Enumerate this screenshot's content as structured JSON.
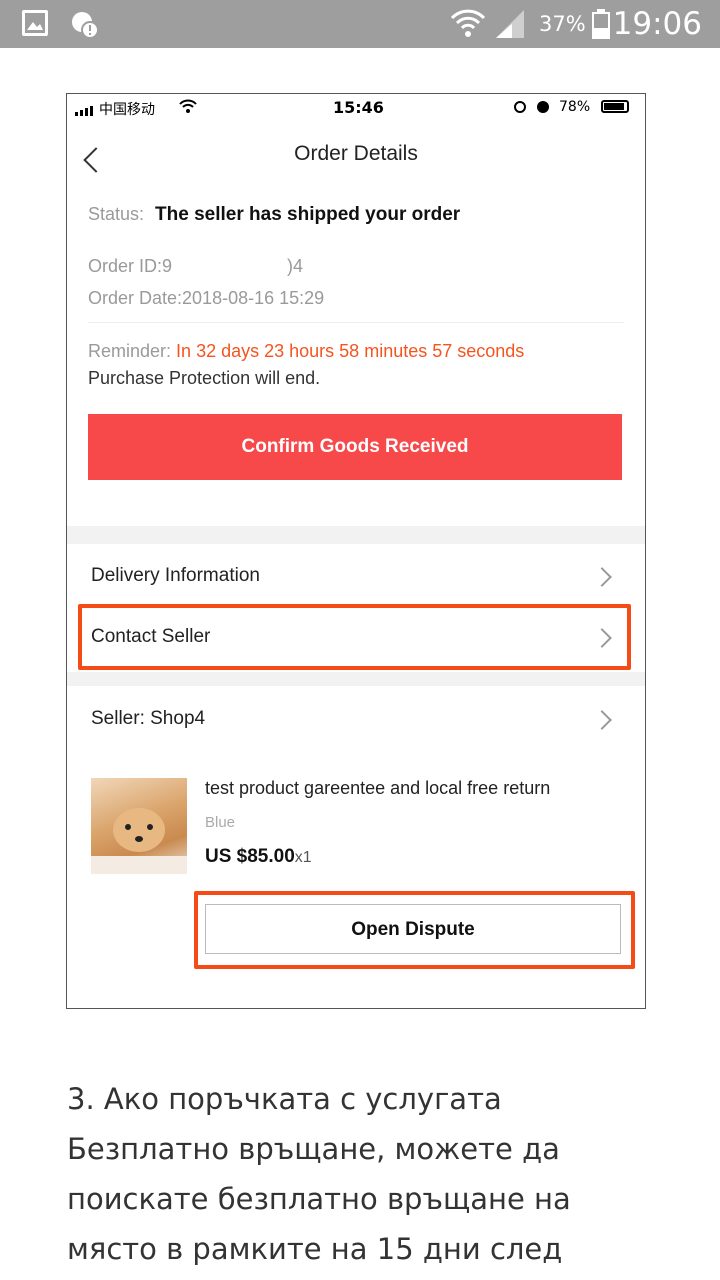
{
  "status_bar": {
    "battery_percent": "37%",
    "time": "19:06"
  },
  "screenshot": {
    "inner_status": {
      "carrier": "中国移动",
      "time": "15:46",
      "battery": "78%"
    },
    "header": {
      "title": "Order Details"
    },
    "order": {
      "status_label": "Status:",
      "status_value": "The seller has shipped your order",
      "order_id": "Order ID:9",
      "order_id_tail": ")4",
      "order_date": "Order Date:2018-08-16 15:29",
      "reminder_label": "Reminder:",
      "reminder_in": "In",
      "reminder_countdown": "32 days 23 hours 58 minutes 57 seconds",
      "reminder_end": "Purchase Protection will end."
    },
    "confirm_button": "Confirm Goods Received",
    "menu": {
      "delivery": "Delivery Information",
      "contact": "Contact Seller",
      "seller": "Seller: Shop4"
    },
    "product": {
      "title": "test product gareentee and local free return",
      "variant": "Blue",
      "price": "US $85.00",
      "qty": "x1"
    },
    "dispute_button": "Open Dispute"
  },
  "article": {
    "text": "3. Ако поръчката с услугата Безплатно връщане, можете да поискате безплатно връщане на място в рамките на 15 дни след"
  },
  "colors": {
    "accent_red": "#f7484a",
    "highlight_orange": "#f54b16",
    "countdown_orange": "#f5541e"
  }
}
